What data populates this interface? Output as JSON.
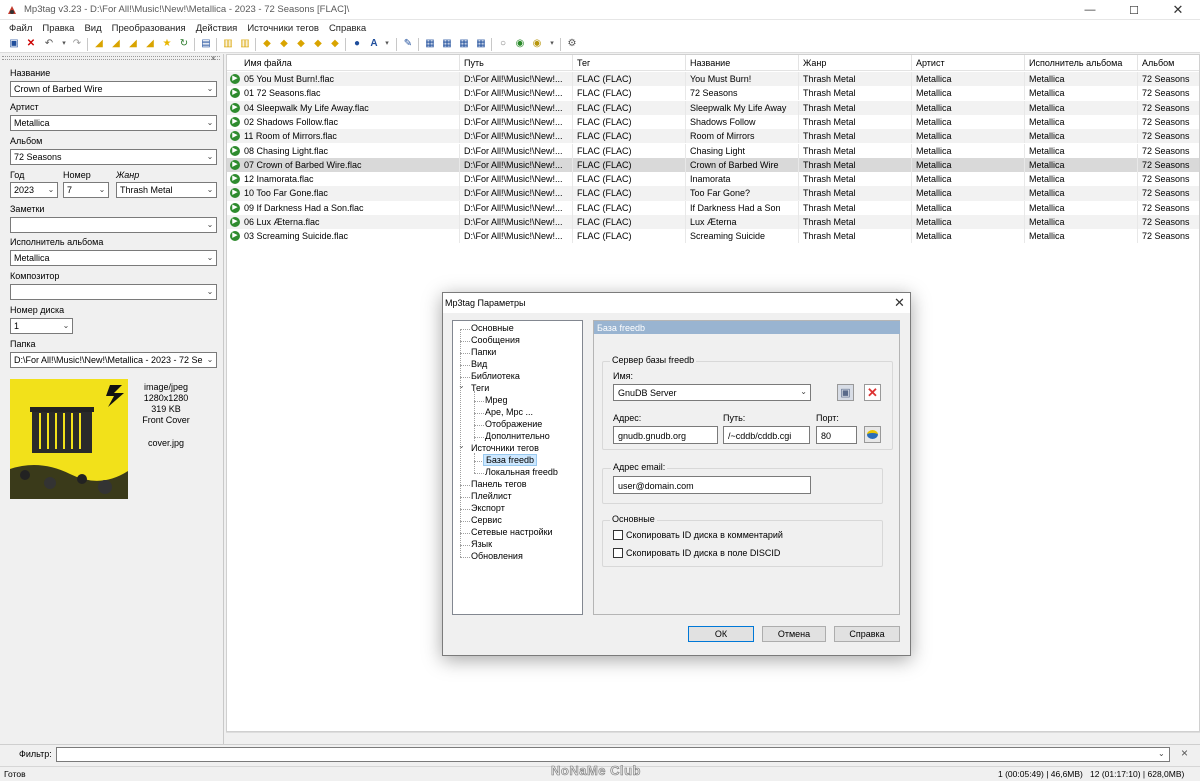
{
  "window": {
    "title": "Mp3tag v3.23  -  D:\\For All!\\Music!\\New!\\Metallica - 2023 - 72 Seasons [FLAC]\\"
  },
  "menu": [
    "Файл",
    "Правка",
    "Вид",
    "Преобразования",
    "Действия",
    "Источники тегов",
    "Справка"
  ],
  "left": {
    "title_label": "Название",
    "title_value": "Crown of Barbed Wire",
    "artist_label": "Артист",
    "artist_value": "Metallica",
    "album_label": "Альбом",
    "album_value": "72 Seasons",
    "year_label": "Год",
    "year_value": "2023",
    "track_label": "Номер",
    "track_value": "7",
    "genre_label": "Жанр",
    "genre_value": "Thrash Metal",
    "comment_label": "Заметки",
    "comment_value": "",
    "albumartist_label": "Исполнитель альбома",
    "albumartist_value": "Metallica",
    "composer_label": "Композитор",
    "composer_value": "",
    "disc_label": "Номер диска",
    "disc_value": "1",
    "folder_label": "Папка",
    "folder_value": "D:\\For All!\\Music!\\New!\\Metallica - 2023 - 72 Se",
    "cover": {
      "mime": "image/jpeg",
      "dims": "1280x1280",
      "size": "319 KB",
      "type": "Front Cover",
      "file": "cover.jpg"
    }
  },
  "columns": [
    "Имя файла",
    "Путь",
    "Тег",
    "Название",
    "Жанр",
    "Артист",
    "Исполнитель альбома",
    "Альбом"
  ],
  "rows": [
    [
      "05 You Must Burn!.flac",
      "D:\\For All!\\Music!\\New!...",
      "FLAC (FLAC)",
      "You Must Burn!",
      "Thrash Metal",
      "Metallica",
      "Metallica",
      "72 Seasons"
    ],
    [
      "01 72 Seasons.flac",
      "D:\\For All!\\Music!\\New!...",
      "FLAC (FLAC)",
      "72 Seasons",
      "Thrash Metal",
      "Metallica",
      "Metallica",
      "72 Seasons"
    ],
    [
      "04 Sleepwalk My Life Away.flac",
      "D:\\For All!\\Music!\\New!...",
      "FLAC (FLAC)",
      "Sleepwalk My Life Away",
      "Thrash Metal",
      "Metallica",
      "Metallica",
      "72 Seasons"
    ],
    [
      "02 Shadows Follow.flac",
      "D:\\For All!\\Music!\\New!...",
      "FLAC (FLAC)",
      "Shadows Follow",
      "Thrash Metal",
      "Metallica",
      "Metallica",
      "72 Seasons"
    ],
    [
      "11 Room of Mirrors.flac",
      "D:\\For All!\\Music!\\New!...",
      "FLAC (FLAC)",
      "Room of Mirrors",
      "Thrash Metal",
      "Metallica",
      "Metallica",
      "72 Seasons"
    ],
    [
      "08 Chasing Light.flac",
      "D:\\For All!\\Music!\\New!...",
      "FLAC (FLAC)",
      "Chasing Light",
      "Thrash Metal",
      "Metallica",
      "Metallica",
      "72 Seasons"
    ],
    [
      "07 Crown of Barbed Wire.flac",
      "D:\\For All!\\Music!\\New!...",
      "FLAC (FLAC)",
      "Crown of Barbed Wire",
      "Thrash Metal",
      "Metallica",
      "Metallica",
      "72 Seasons"
    ],
    [
      "12 Inamorata.flac",
      "D:\\For All!\\Music!\\New!...",
      "FLAC (FLAC)",
      "Inamorata",
      "Thrash Metal",
      "Metallica",
      "Metallica",
      "72 Seasons"
    ],
    [
      "10 Too Far Gone.flac",
      "D:\\For All!\\Music!\\New!...",
      "FLAC (FLAC)",
      "Too Far Gone?",
      "Thrash Metal",
      "Metallica",
      "Metallica",
      "72 Seasons"
    ],
    [
      "09 If Darkness Had a Son.flac",
      "D:\\For All!\\Music!\\New!...",
      "FLAC (FLAC)",
      "If Darkness Had a Son",
      "Thrash Metal",
      "Metallica",
      "Metallica",
      "72 Seasons"
    ],
    [
      "06 Lux Æterna.flac",
      "D:\\For All!\\Music!\\New!...",
      "FLAC (FLAC)",
      "Lux Æterna",
      "Thrash Metal",
      "Metallica",
      "Metallica",
      "72 Seasons"
    ],
    [
      "03 Screaming Suicide.flac",
      "D:\\For All!\\Music!\\New!...",
      "FLAC (FLAC)",
      "Screaming Suicide",
      "Thrash Metal",
      "Metallica",
      "Metallica",
      "72 Seasons"
    ]
  ],
  "selected_row": 6,
  "filter": {
    "label": "Фильтр:",
    "value": ""
  },
  "status": {
    "left": "Готов",
    "sel": "1 (00:05:49) | 46,6MB)",
    "total": "12 (01:17:10) | 628,0MB)"
  },
  "watermark": "NoNaMe Club",
  "dialog": {
    "title": "Mp3tag Параметры",
    "tree": [
      "Основные",
      "Сообщения",
      "Папки",
      "Вид",
      "Библиотека",
      "Теги",
      "Mpeg",
      "Ape, Mpc ...",
      "Отображение",
      "Дополнительно",
      "Источники тегов",
      "База freedb",
      "Локальная freedb",
      "Панель тегов",
      "Плейлист",
      "Экспорт",
      "Сервис",
      "Сетевые настройки",
      "Язык",
      "Обновления"
    ],
    "selected": "База freedb",
    "pane_title": "База freedb",
    "server_group": "Сервер базы freedb",
    "name_label": "Имя:",
    "name_value": "GnuDB Server",
    "addr_label": "Адрес:",
    "addr_value": "gnudb.gnudb.org",
    "path_label": "Путь:",
    "path_value": "/~cddb/cddb.cgi",
    "port_label": "Порт:",
    "port_value": "80",
    "email_label": "Адрес email:",
    "email_value": "user@domain.com",
    "main_group": "Основные",
    "chk1": "Скопировать ID диска в комментарий",
    "chk2": "Скопировать ID диска в поле DISCID",
    "ok": "ОК",
    "cancel": "Отмена",
    "help": "Справка"
  },
  "colors": {
    "selected_row": "#d9d9d9",
    "alt_row": "#f2f2f2",
    "pane_header": "#99b4d1",
    "cover_bg": "#f2e11a"
  }
}
